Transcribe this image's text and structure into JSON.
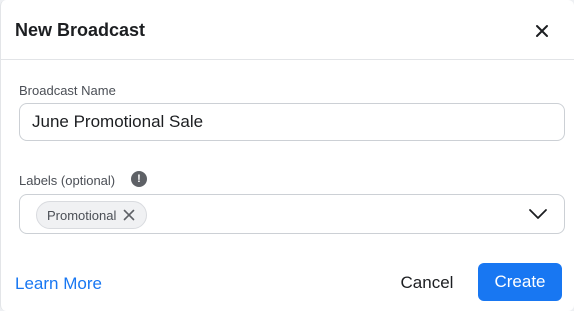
{
  "dialog": {
    "title": "New Broadcast",
    "close_icon": "close-icon"
  },
  "form": {
    "broadcast_name": {
      "label": "Broadcast Name",
      "value": "June Promotional Sale"
    },
    "labels": {
      "label": "Labels (optional)",
      "info_icon": "info-icon",
      "info_glyph": "!",
      "selected": [
        {
          "label": "Promotional",
          "remove_icon": "close-icon"
        }
      ],
      "dropdown_icon": "chevron-down-icon"
    }
  },
  "footer": {
    "learn_more": "Learn More",
    "cancel": "Cancel",
    "create": "Create"
  },
  "colors": {
    "primary": "#1877f2",
    "text": "#1c1e21",
    "muted": "#4b4f56",
    "border": "#ccd0d5"
  }
}
